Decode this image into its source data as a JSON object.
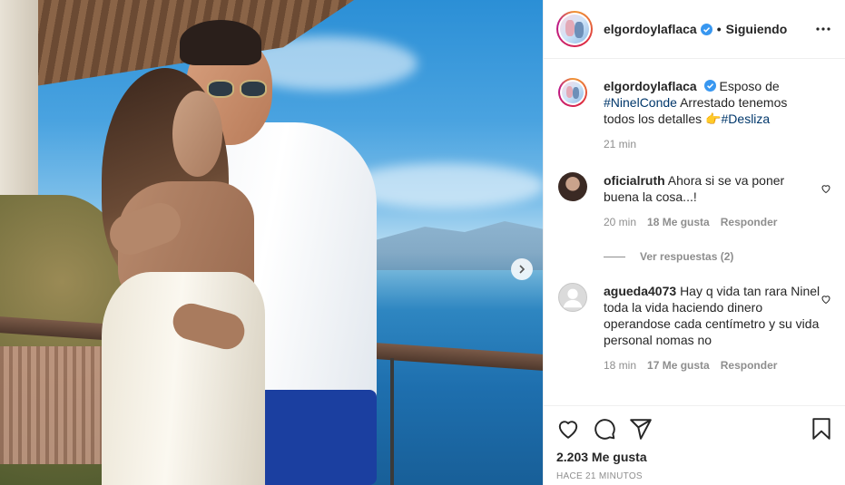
{
  "post": {
    "account": "elgordoylaflaca",
    "follow_label": "Siguiendo",
    "caption": {
      "text_1": "Esposo de",
      "hashtag_1": "#NinelConde",
      "text_2": "Arrestado tenemos todos los detalles",
      "emoji": "👉",
      "hashtag_2": "#Desliza",
      "time": "21 min"
    },
    "likes": "2.203 Me gusta",
    "posted": "HACE 21 MINUTOS"
  },
  "comments": [
    {
      "user": "oficialruth",
      "text": "Ahora si se va poner buena la cosa...!",
      "time": "20 min",
      "likes": "18 Me gusta",
      "reply_label": "Responder",
      "view_replies": "Ver respuestas (2)"
    },
    {
      "user": "agueda4073",
      "text": "Hay q vida tan rara Ninel toda la vida haciendo dinero operandose cada centímetro y su vida personal nomas no",
      "time": "18 min",
      "likes": "17 Me gusta",
      "reply_label": "Responder"
    }
  ],
  "icons": {
    "like": "heart-icon",
    "comment": "comment-icon",
    "share": "share-icon",
    "save": "bookmark-icon",
    "more": "more-icon",
    "next": "chevron-right-icon",
    "verified": "verified-badge-icon"
  },
  "colors": {
    "text": "#262626",
    "muted": "#8e8e8e",
    "hashtag": "#00376b",
    "verified": "#3897f0",
    "pants": "#1b3fa0"
  }
}
